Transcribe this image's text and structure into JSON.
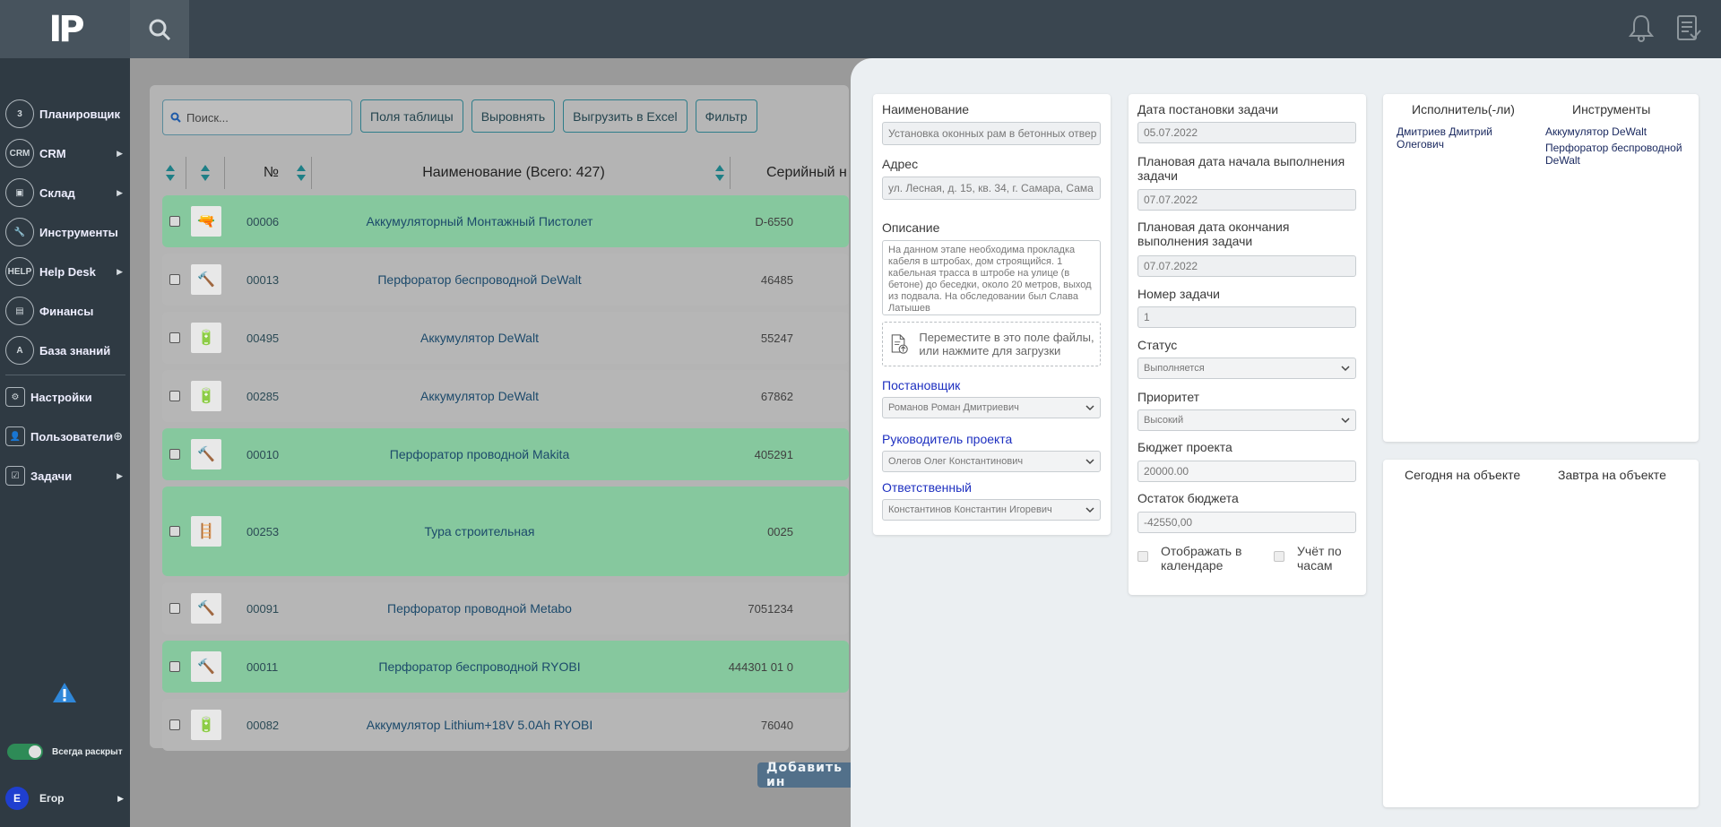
{
  "app": {
    "logo": "IP"
  },
  "sidebar": {
    "items": [
      {
        "label": "Планировщик",
        "icon": "calendar-icon",
        "icon_text": "3",
        "arrow": ""
      },
      {
        "label": "CRM",
        "icon": "crm-icon",
        "icon_text": "CRM",
        "arrow": "▶"
      },
      {
        "label": "Склад",
        "icon": "warehouse-icon",
        "icon_text": "",
        "arrow": "▶"
      },
      {
        "label": "Инструменты",
        "icon": "tools-icon",
        "icon_text": "",
        "arrow": ""
      },
      {
        "label": "Help Desk",
        "icon": "helpdesk-icon",
        "icon_text": "HELP",
        "arrow": "▶"
      },
      {
        "label": "Финансы",
        "icon": "finance-icon",
        "icon_text": "",
        "arrow": ""
      },
      {
        "label": "База знаний",
        "icon": "knowledge-icon",
        "icon_text": "A",
        "arrow": ""
      },
      {
        "label": "Настройки",
        "icon": "gear-icon",
        "icon_text": "",
        "arrow": ""
      },
      {
        "label": "Пользователи",
        "icon": "users-icon",
        "icon_text": "",
        "arrow": ""
      },
      {
        "label": "Задачи",
        "icon": "tasks-icon",
        "icon_text": "",
        "arrow": "▶"
      }
    ],
    "always_open_label": "Всегда раскрыт",
    "user": {
      "initial": "E",
      "name": "Егор",
      "arrow": "▶"
    }
  },
  "table": {
    "search_placeholder": "Поиск...",
    "buttons": [
      "Поля таблицы",
      "Выровнять",
      "Выгрузить в Excel",
      "Фильтр"
    ],
    "headers": {
      "num": "№",
      "name": "Наименование (Всего: 427)",
      "serial": "Серийный н"
    },
    "rows": [
      {
        "num": "00006",
        "name": "Аккумуляторный Монтажный Пистолет",
        "serial": "D-6550",
        "color": "green",
        "icon": "🔫"
      },
      {
        "num": "00013",
        "name": "Перфоратор беспроводной DeWalt",
        "serial": "46485",
        "color": "gray",
        "icon": "🔨"
      },
      {
        "num": "00495",
        "name": "Аккумулятор DeWalt",
        "serial": "55247",
        "color": "gray",
        "icon": "🔋"
      },
      {
        "num": "00285",
        "name": "Аккумулятор DeWalt",
        "serial": "67862",
        "color": "gray",
        "icon": "🔋"
      },
      {
        "num": "00010",
        "name": "Перфоратор проводной Makita",
        "serial": "405291",
        "color": "green",
        "icon": "🔨"
      },
      {
        "num": "00253",
        "name": "Тура строительная",
        "serial": "0025",
        "color": "green",
        "icon": "🪜"
      },
      {
        "num": "00091",
        "name": "Перфоратор проводной Metabo",
        "serial": "7051234",
        "color": "gray",
        "icon": "🔨"
      },
      {
        "num": "00011",
        "name": "Перфоратор беспроводной RYOBI",
        "serial": "444301 01 0",
        "color": "green",
        "icon": "🔨"
      },
      {
        "num": "00082",
        "name": "Аккумулятор Lithium+18V 5.0Ah RYOBI",
        "serial": "76040",
        "color": "gray",
        "icon": "🔋"
      }
    ],
    "add_button": "Добавить ин"
  },
  "task": {
    "col1": {
      "name_label": "Наименование",
      "name_value": "Установка оконных рам в бетонных отвер",
      "address_label": "Адрес",
      "address_value": "ул. Лесная, д. 15, кв. 34, г. Самара, Сама",
      "description_label": "Описание",
      "description_value": "На данном этапе необходима прокладка кабеля в штробах, дом строящийся. 1 кабельная трасса в штробе на улице (в бетоне) до беседки, около 20 метров, выход из подвала. На обследовании был Слава Латышев",
      "dropzone_text": "Переместите в это поле файлы, или нажмите для загрузки",
      "setter_label": "Постановщик",
      "setter_value": "Романов Роман Дмитриевич",
      "manager_label": "Руководитель проекта",
      "manager_value": "Олегов Олег Константинович",
      "responsible_label": "Ответственный",
      "responsible_value": "Константинов Константин Игоревич"
    },
    "col2": {
      "date_set_label": "Дата постановки задачи",
      "date_set_value": "05.07.2022",
      "start_label": "Плановая дата начала выполнения задачи",
      "start_value": "07.07.2022",
      "end_label": "Плановая дата окончания выполнения задачи",
      "end_value": "07.07.2022",
      "number_label": "Номер задачи",
      "number_value": "1",
      "status_label": "Статус",
      "status_value": "Выполняется",
      "priority_label": "Приоритет",
      "priority_value": "Высокий",
      "budget_label": "Бюджет проекта",
      "budget_value": "20000.00",
      "remain_label": "Остаток бюджета",
      "remain_value": "-42550,00",
      "calendar_label": "Отображать в календаре",
      "hours_label": "Учёт по часам"
    },
    "col3": {
      "executors_header": "Исполнитель(-ли)",
      "tools_header": "Инструменты",
      "executor": "Дмитриев Дмитрий Олегович",
      "tools": [
        "Аккумулятор DeWalt",
        "Перфоратор беспроводной DeWalt"
      ],
      "today_header": "Сегодня на объекте",
      "tomorrow_header": "Завтра на объекте"
    }
  }
}
